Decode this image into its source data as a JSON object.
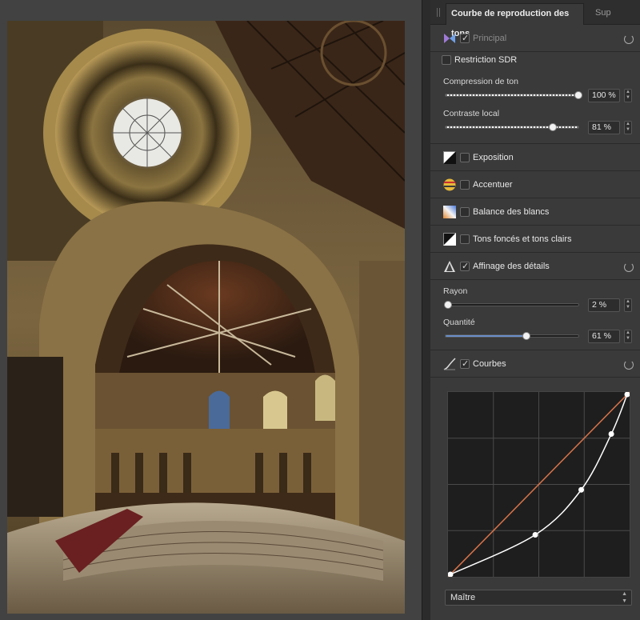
{
  "panel": {
    "tab_active": "Courbe de reproduction des tons",
    "tab_other": "Sup",
    "principal": {
      "label": "Principal",
      "checked": true
    },
    "restriction_sdr": {
      "label": "Restriction SDR",
      "checked": false
    },
    "compression": {
      "label": "Compression de ton",
      "value": "100 %",
      "fraction": 1.0
    },
    "contraste": {
      "label": "Contraste local",
      "value": "81 %",
      "fraction": 0.81
    },
    "adjustments": [
      {
        "label": "Exposition",
        "icon": "exposure-icon",
        "checked": false
      },
      {
        "label": "Accentuer",
        "icon": "vibrance-icon",
        "checked": false
      },
      {
        "label": "Balance des blancs",
        "icon": "white-balance-icon",
        "checked": false
      },
      {
        "label": "Tons foncés et tons clairs",
        "icon": "shadows-highlights-icon",
        "checked": false
      }
    ],
    "detail": {
      "label": "Affinage des détails",
      "checked": true
    },
    "rayon": {
      "label": "Rayon",
      "value": "2 %",
      "fraction": 0.02
    },
    "quantite": {
      "label": "Quantité",
      "value": "61 %",
      "fraction": 0.61
    },
    "curves": {
      "label": "Courbes",
      "checked": true,
      "channel": "Maître",
      "points": [
        [
          0,
          0
        ],
        [
          0.48,
          0.22
        ],
        [
          0.74,
          0.47
        ],
        [
          0.91,
          0.78
        ],
        [
          1,
          1
        ]
      ],
      "diagonal_color": "#d9744a"
    },
    "colors": {
      "accent": "#6a8fc9",
      "panel_bg": "#3a3a3a"
    }
  }
}
